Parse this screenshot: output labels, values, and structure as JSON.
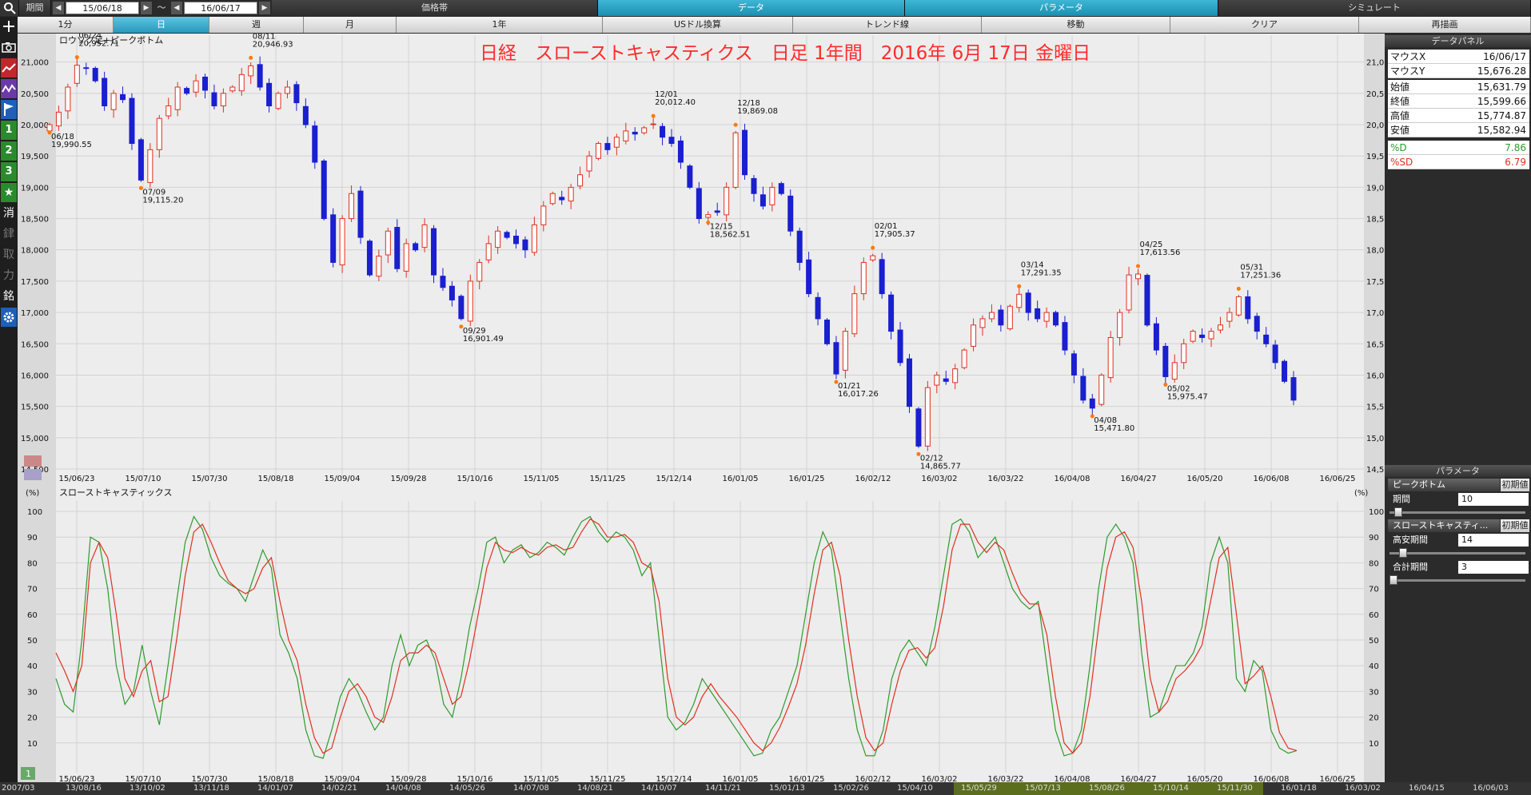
{
  "topbar": {
    "period_label": "期間",
    "start_date": "15/06/18",
    "range_sep": "～",
    "end_date": "16/06/17",
    "tabs": [
      {
        "label": "価格帯",
        "active": false
      },
      {
        "label": "データ",
        "active": true
      },
      {
        "label": "パラメータ",
        "active": true
      },
      {
        "label": "シミュレート",
        "active": false
      }
    ]
  },
  "secondbar": {
    "items": [
      {
        "label": "1分",
        "active": false
      },
      {
        "label": "日",
        "active": true
      },
      {
        "label": "週",
        "active": false
      },
      {
        "label": "月",
        "active": false
      },
      {
        "label": "1年",
        "active": false
      },
      {
        "label": "USドル換算",
        "active": false
      },
      {
        "label": "トレンド線",
        "active": false
      },
      {
        "label": "移動",
        "active": false
      },
      {
        "label": "クリア",
        "active": false
      },
      {
        "label": "再描画",
        "active": false
      }
    ]
  },
  "lefttools": {
    "icons": [
      "search-icon",
      "plus-icon",
      "camera-icon",
      "line-chart-icon",
      "indicator-icon",
      "flag-icon",
      "one-icon",
      "two-icon",
      "three-icon",
      "star-icon",
      "erase-icon",
      "kanji-ken-icon",
      "kanji-tori-icon",
      "kanji-chikara-icon",
      "kanji-mei-icon",
      "gear-icon"
    ],
    "labels": [
      "",
      "",
      "",
      "",
      "",
      "",
      "1",
      "2",
      "3",
      "★",
      "消",
      "銉",
      "取",
      "力",
      "銘",
      ""
    ]
  },
  "chart_data": [
    {
      "type": "candlestick",
      "panel_label": "ロウソク足+ピークボトム",
      "title": "日経　スローストキャスティクス　日足 1年間　2016年 6月 17日 金曜日",
      "ylim": [
        14500,
        21200
      ],
      "yticks": [
        14500,
        15000,
        15500,
        16000,
        16500,
        17000,
        17500,
        18000,
        18500,
        19000,
        19500,
        20000,
        20500,
        21000
      ],
      "ytick_labels": [
        "14,500",
        "15,000",
        "15,500",
        "16,000",
        "16,500",
        "17,000",
        "17,500",
        "18,000",
        "18,500",
        "19,000",
        "19,500",
        "20,000",
        "20,500",
        "21,000"
      ],
      "xtick_labels": [
        "15/06/23",
        "15/07/10",
        "15/07/30",
        "15/08/18",
        "15/09/04",
        "15/09/28",
        "15/10/16",
        "15/11/05",
        "15/11/25",
        "15/12/14",
        "16/01/05",
        "16/01/25",
        "16/02/12",
        "16/03/02",
        "16/03/22",
        "16/04/08",
        "16/04/27",
        "16/05/20",
        "16/06/08",
        "16/06/25"
      ],
      "close_path": [
        20000,
        20200,
        20600,
        20950,
        20900,
        20700,
        20300,
        20500,
        20400,
        19700,
        19115,
        19600,
        20100,
        20300,
        20600,
        20500,
        20700,
        20550,
        20300,
        20500,
        20600,
        20800,
        20940,
        20600,
        20300,
        20500,
        20600,
        20350,
        20000,
        19400,
        18500,
        17800,
        18500,
        18900,
        18200,
        17600,
        17900,
        18300,
        17700,
        18100,
        18000,
        18400,
        17600,
        17400,
        17200,
        16902,
        17500,
        17800,
        18100,
        18300,
        18200,
        18100,
        18000,
        18400,
        18700,
        18900,
        18800,
        19000,
        19200,
        19500,
        19700,
        19600,
        19800,
        19900,
        19850,
        19950,
        20012,
        19800,
        19700,
        19400,
        19000,
        18500,
        18563,
        18600,
        19000,
        19870,
        19200,
        18900,
        18700,
        19000,
        18900,
        18300,
        17800,
        17300,
        16900,
        16500,
        16018,
        16700,
        17300,
        17800,
        17906,
        17300,
        16700,
        16200,
        15500,
        14866,
        15800,
        16000,
        15900,
        16100,
        16400,
        16800,
        16900,
        17000,
        16800,
        17100,
        17291,
        17000,
        16900,
        17000,
        16800,
        16400,
        16000,
        15600,
        15472,
        16000,
        16600,
        17000,
        17600,
        17614,
        16800,
        16400,
        15975,
        16200,
        16500,
        16700,
        16600,
        16700,
        16800,
        17000,
        17251,
        16900,
        16700,
        16500,
        16200,
        15900,
        15600
      ],
      "annotations": [
        {
          "date": "06/18",
          "value": "19,990.55"
        },
        {
          "date": "06/24",
          "value": "20,952.71"
        },
        {
          "date": "07/09",
          "value": "19,115.20"
        },
        {
          "date": "08/11",
          "value": "20,946.93"
        },
        {
          "date": "09/29",
          "value": "16,901.49"
        },
        {
          "date": "12/01",
          "value": "20,012.40"
        },
        {
          "date": "12/18",
          "value": "19,869.08"
        },
        {
          "date": "12/15",
          "value": "18,562.51"
        },
        {
          "date": "01/21",
          "value": "16,017.26"
        },
        {
          "date": "02/01",
          "value": "17,905.37"
        },
        {
          "date": "02/12",
          "value": "14,865.77"
        },
        {
          "date": "03/14",
          "value": "17,291.35"
        },
        {
          "date": "04/08",
          "value": "15,471.80"
        },
        {
          "date": "04/25",
          "value": "17,613.56"
        },
        {
          "date": "05/02",
          "value": "15,975.47"
        },
        {
          "date": "05/31",
          "value": "17,251.36"
        }
      ]
    },
    {
      "type": "line",
      "panel_label": "スローストキャスティックス",
      "unit_label": "(%)",
      "ylim": [
        0,
        100
      ],
      "yticks": [
        10,
        20,
        30,
        40,
        50,
        60,
        70,
        80,
        90,
        100
      ],
      "xtick_labels": [
        "15/06/23",
        "15/07/10",
        "15/07/30",
        "15/08/18",
        "15/09/04",
        "15/09/28",
        "15/10/16",
        "15/11/05",
        "15/11/25",
        "15/12/14",
        "16/01/05",
        "16/01/25",
        "16/02/12",
        "16/03/02",
        "16/03/22",
        "16/04/08",
        "16/04/27",
        "16/05/20",
        "16/06/08",
        "16/06/25"
      ],
      "series": [
        {
          "color": "#2e9a2e",
          "values": [
            35,
            25,
            22,
            50,
            90,
            88,
            70,
            40,
            25,
            30,
            48,
            30,
            17,
            40,
            65,
            88,
            98,
            93,
            82,
            75,
            72,
            70,
            65,
            75,
            85,
            78,
            52,
            45,
            35,
            15,
            5,
            4,
            15,
            28,
            35,
            30,
            22,
            15,
            20,
            40,
            52,
            40,
            48,
            50,
            42,
            25,
            20,
            35,
            55,
            70,
            88,
            90,
            80,
            85,
            87,
            82,
            84,
            88,
            86,
            83,
            90,
            96,
            98,
            92,
            88,
            92,
            90,
            85,
            75,
            80,
            50,
            20,
            15,
            18,
            25,
            35,
            30,
            25,
            20,
            15,
            10,
            5,
            6,
            15,
            20,
            30,
            40,
            60,
            80,
            92,
            85,
            60,
            35,
            15,
            5,
            5,
            15,
            35,
            45,
            50,
            45,
            40,
            55,
            75,
            95,
            97,
            92,
            82,
            86,
            90,
            80,
            70,
            65,
            62,
            65,
            40,
            15,
            5,
            6,
            15,
            40,
            70,
            90,
            95,
            90,
            80,
            45,
            20,
            22,
            32,
            40,
            40,
            45,
            55,
            80,
            90,
            80,
            35,
            30,
            42,
            38,
            15,
            8,
            6,
            7
          ]
        },
        {
          "color": "#e0301e",
          "values": [
            45,
            38,
            30,
            40,
            80,
            88,
            82,
            60,
            35,
            28,
            38,
            42,
            26,
            28,
            50,
            75,
            92,
            95,
            88,
            80,
            73,
            70,
            68,
            70,
            78,
            82,
            65,
            50,
            42,
            25,
            12,
            6,
            8,
            20,
            30,
            33,
            28,
            20,
            18,
            28,
            42,
            45,
            45,
            48,
            45,
            35,
            25,
            28,
            42,
            60,
            78,
            88,
            85,
            84,
            86,
            84,
            83,
            86,
            87,
            85,
            86,
            92,
            97,
            95,
            90,
            90,
            91,
            88,
            80,
            78,
            65,
            35,
            20,
            17,
            20,
            28,
            33,
            28,
            24,
            20,
            15,
            10,
            7,
            10,
            16,
            24,
            33,
            48,
            68,
            85,
            88,
            75,
            50,
            28,
            12,
            7,
            10,
            25,
            38,
            46,
            47,
            43,
            47,
            63,
            85,
            95,
            95,
            88,
            84,
            88,
            85,
            76,
            68,
            64,
            64,
            52,
            28,
            10,
            6,
            10,
            28,
            55,
            78,
            90,
            92,
            86,
            65,
            35,
            22,
            26,
            35,
            38,
            42,
            48,
            65,
            82,
            86,
            60,
            33,
            36,
            40,
            28,
            14,
            8,
            7
          ]
        }
      ]
    }
  ],
  "datapanel": {
    "header": "データパネル",
    "rows": [
      {
        "label": "マウスX",
        "value": "16/06/17",
        "color": "#111111"
      },
      {
        "label": "マウスY",
        "value": "15,676.28",
        "color": "#111111"
      },
      {
        "label": "始値",
        "value": "15,631.79",
        "color": "#111111"
      },
      {
        "label": "終値",
        "value": "15,599.66",
        "color": "#111111"
      },
      {
        "label": "高値",
        "value": "15,774.87",
        "color": "#111111"
      },
      {
        "label": "安値",
        "value": "15,582.94",
        "color": "#111111"
      },
      {
        "label": "%D",
        "value": "7.86",
        "color": "#2e9a2e"
      },
      {
        "label": "%SD",
        "value": "6.79",
        "color": "#e0301e"
      }
    ]
  },
  "params": {
    "header": "パラメータ",
    "sections": [
      {
        "title": "ピークボトム",
        "reset": "初期値",
        "fields": [
          {
            "label": "期間",
            "value": "10",
            "slider": 0.05
          }
        ]
      },
      {
        "title": "スローストキャスティ...",
        "reset": "初期値",
        "fields": [
          {
            "label": "高安期間",
            "value": "14",
            "slider": 0.08
          },
          {
            "label": "合計期間",
            "value": "3",
            "slider": 0.0
          }
        ]
      }
    ]
  },
  "bottombar": {
    "dates": [
      "2007/03",
      "13/08/16",
      "13/10/02",
      "13/11/18",
      "14/01/07",
      "14/02/21",
      "14/04/08",
      "14/05/26",
      "14/07/08",
      "14/08/21",
      "14/10/07",
      "14/11/21",
      "15/01/13",
      "15/02/26",
      "15/04/10",
      "15/05/29",
      "15/07/13",
      "15/08/26",
      "15/10/14",
      "15/11/30",
      "16/01/18",
      "16/03/02",
      "16/04/15",
      "16/06/03"
    ]
  }
}
